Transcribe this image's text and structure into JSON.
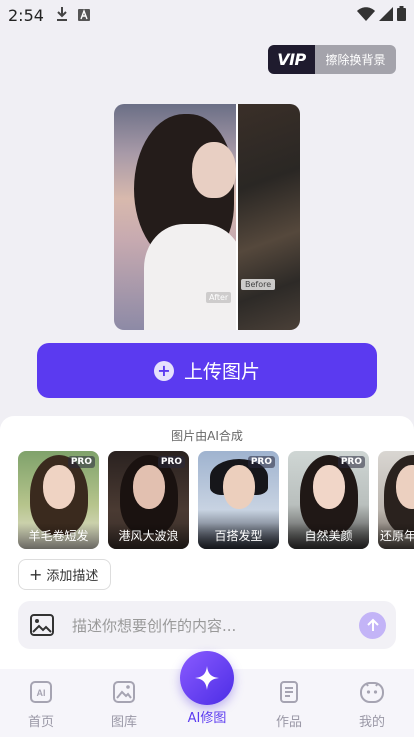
{
  "status_bar": {
    "time": "2:54"
  },
  "vip": {
    "badge": "VIP",
    "label": "擦除换背景"
  },
  "compare": {
    "after_label": "After",
    "before_label": "Before"
  },
  "upload": {
    "label": "上传图片"
  },
  "sheet": {
    "title": "图片由AI合成",
    "styles": [
      {
        "name": "羊毛卷短发",
        "pro": "PRO"
      },
      {
        "name": "港风大波浪",
        "pro": "PRO"
      },
      {
        "name": "百搭发型",
        "pro": "PRO"
      },
      {
        "name": "自然美颜",
        "pro": "PRO"
      },
      {
        "name": "还原年",
        "pro": ""
      }
    ],
    "add_description": "添加描述",
    "input_placeholder": "描述你想要创作的内容..."
  },
  "tabbar": {
    "tabs": [
      {
        "label": "首页"
      },
      {
        "label": "图库"
      },
      {
        "label": "AI修图"
      },
      {
        "label": "作品"
      },
      {
        "label": "我的"
      }
    ]
  },
  "colors": {
    "accent": "#5b3af0",
    "background": "#f0eff4"
  }
}
